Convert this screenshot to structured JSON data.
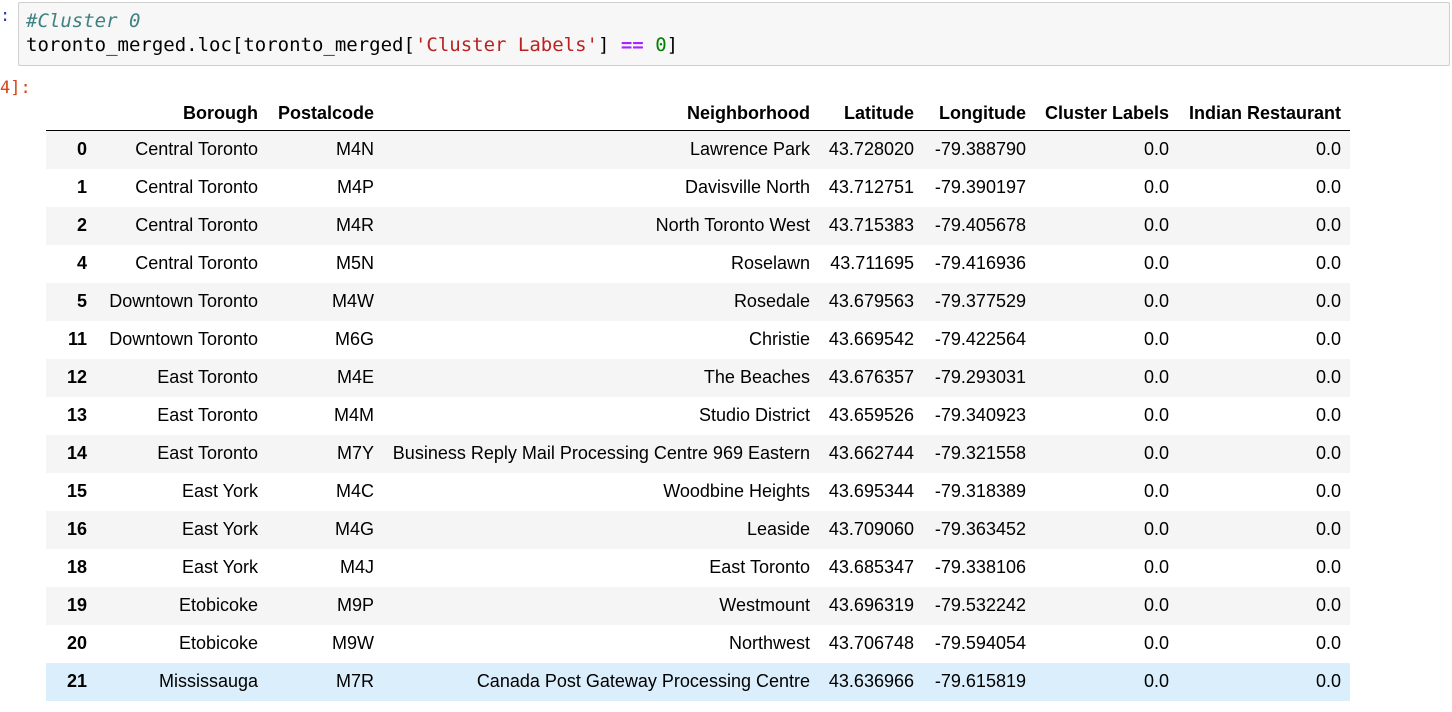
{
  "input_prompt": ":",
  "code": {
    "comment": "#Cluster 0",
    "line2_pre": "toronto_merged.loc[toronto_merged[",
    "line2_string": "'Cluster Labels'",
    "line2_mid": "] ",
    "line2_op": "==",
    "line2_space": " ",
    "line2_num": "0",
    "line2_post": "]"
  },
  "output_prompt": "4]:",
  "table": {
    "columns": [
      "",
      "Borough",
      "Postalcode",
      "Neighborhood",
      "Latitude",
      "Longitude",
      "Cluster Labels",
      "Indian Restaurant"
    ],
    "rows": [
      [
        "0",
        "Central Toronto",
        "M4N",
        "Lawrence Park",
        "43.728020",
        "-79.388790",
        "0.0",
        "0.0"
      ],
      [
        "1",
        "Central Toronto",
        "M4P",
        "Davisville North",
        "43.712751",
        "-79.390197",
        "0.0",
        "0.0"
      ],
      [
        "2",
        "Central Toronto",
        "M4R",
        "North Toronto West",
        "43.715383",
        "-79.405678",
        "0.0",
        "0.0"
      ],
      [
        "4",
        "Central Toronto",
        "M5N",
        "Roselawn",
        "43.711695",
        "-79.416936",
        "0.0",
        "0.0"
      ],
      [
        "5",
        "Downtown Toronto",
        "M4W",
        "Rosedale",
        "43.679563",
        "-79.377529",
        "0.0",
        "0.0"
      ],
      [
        "11",
        "Downtown Toronto",
        "M6G",
        "Christie",
        "43.669542",
        "-79.422564",
        "0.0",
        "0.0"
      ],
      [
        "12",
        "East Toronto",
        "M4E",
        "The Beaches",
        "43.676357",
        "-79.293031",
        "0.0",
        "0.0"
      ],
      [
        "13",
        "East Toronto",
        "M4M",
        "Studio District",
        "43.659526",
        "-79.340923",
        "0.0",
        "0.0"
      ],
      [
        "14",
        "East Toronto",
        "M7Y",
        "Business Reply Mail Processing Centre 969 Eastern",
        "43.662744",
        "-79.321558",
        "0.0",
        "0.0"
      ],
      [
        "15",
        "East York",
        "M4C",
        "Woodbine Heights",
        "43.695344",
        "-79.318389",
        "0.0",
        "0.0"
      ],
      [
        "16",
        "East York",
        "M4G",
        "Leaside",
        "43.709060",
        "-79.363452",
        "0.0",
        "0.0"
      ],
      [
        "18",
        "East York",
        "M4J",
        "East Toronto",
        "43.685347",
        "-79.338106",
        "0.0",
        "0.0"
      ],
      [
        "19",
        "Etobicoke",
        "M9P",
        "Westmount",
        "43.696319",
        "-79.532242",
        "0.0",
        "0.0"
      ],
      [
        "20",
        "Etobicoke",
        "M9W",
        "Northwest",
        "43.706748",
        "-79.594054",
        "0.0",
        "0.0"
      ],
      [
        "21",
        "Mississauga",
        "M7R",
        "Canada Post Gateway Processing Centre",
        "43.636966",
        "-79.615819",
        "0.0",
        "0.0"
      ]
    ],
    "hover_row_index": 14,
    "colors": {
      "row_stripe": "#f5f5f5",
      "row_hover": "#dbeefb"
    }
  }
}
